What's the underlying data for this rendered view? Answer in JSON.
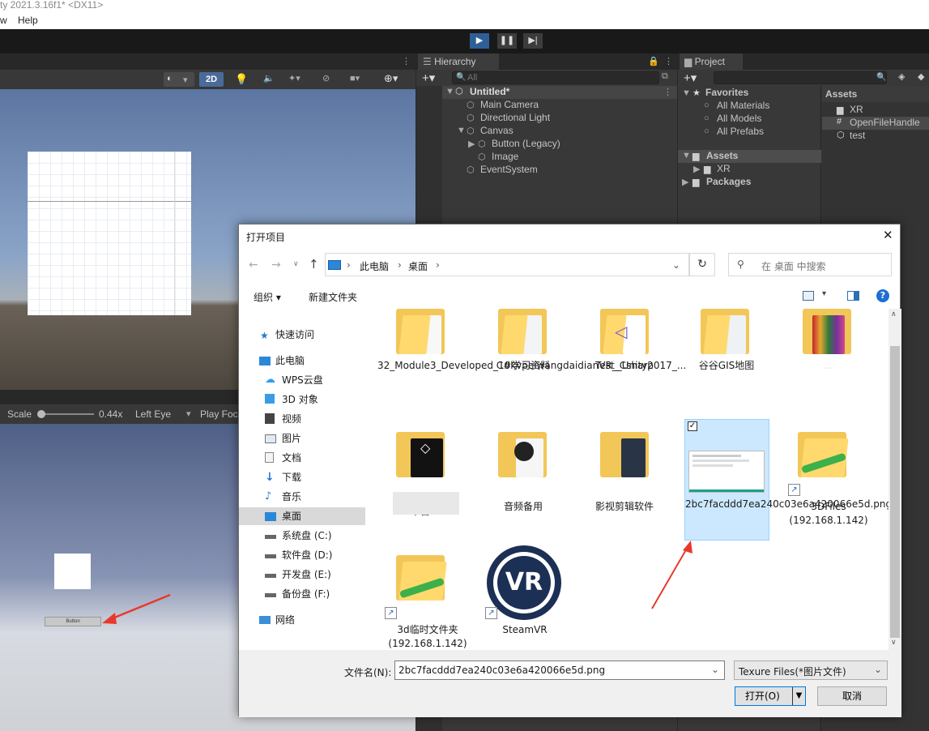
{
  "window": {
    "title": "ty 2021.3.16f1* <DX11>",
    "menu": [
      "w",
      "Help"
    ]
  },
  "scene_toolbar": {
    "mode_2d": "2D"
  },
  "game_toolbar": {
    "scale_label": "Scale",
    "scale_value": "0.44x",
    "eye": "Left Eye",
    "play_focus": "Play Foc"
  },
  "hierarchy": {
    "tab": "Hierarchy",
    "search_placeholder": "All",
    "items": [
      {
        "label": "Untitled*"
      },
      {
        "label": "Main Camera"
      },
      {
        "label": "Directional Light"
      },
      {
        "label": "Canvas"
      },
      {
        "label": "Button (Legacy)"
      },
      {
        "label": "Image"
      },
      {
        "label": "EventSystem"
      }
    ]
  },
  "project": {
    "tab": "Project",
    "favorites_header": "Favorites",
    "favorites": [
      "All Materials",
      "All Models",
      "All Prefabs"
    ],
    "assets_header": "Assets",
    "assets_tree": [
      "XR"
    ],
    "packages": "Packages",
    "assets_panel_title": "Assets",
    "assets_items": [
      "XR",
      "OpenFileHandle",
      "test"
    ]
  },
  "game_view": {
    "button_text": "Button"
  },
  "dialog": {
    "title": "打开项目",
    "close": "✕",
    "breadcrumb": [
      "此电脑",
      "桌面"
    ],
    "search_placeholder": "在 桌面 中搜索",
    "organize": "组织 ▾",
    "new_folder": "新建文件夹",
    "sidebar": [
      {
        "label": "快速访问",
        "icon": "star-icon"
      },
      {
        "label": "此电脑",
        "icon": "computer-icon"
      },
      {
        "label": "WPS云盘",
        "icon": "cloud-icon"
      },
      {
        "label": "3D 对象",
        "icon": "cube-icon"
      },
      {
        "label": "视频",
        "icon": "video-icon"
      },
      {
        "label": "图片",
        "icon": "picture-icon"
      },
      {
        "label": "文档",
        "icon": "document-icon"
      },
      {
        "label": "下载",
        "icon": "download-icon"
      },
      {
        "label": "音乐",
        "icon": "music-icon"
      },
      {
        "label": "桌面",
        "icon": "desktop-icon"
      },
      {
        "label": "系统盘 (C:)",
        "icon": "drive-icon"
      },
      {
        "label": "软件盘 (D:)",
        "icon": "drive-icon"
      },
      {
        "label": "开发盘 (E:)",
        "icon": "drive-icon"
      },
      {
        "label": "备份盘 (F:)",
        "icon": "drive-icon"
      },
      {
        "label": "网络",
        "icon": "network-icon"
      }
    ],
    "files": [
      {
        "name": "32_Module3_Developed_10kvpeiwangdaidianVR__Unity2017_..."
      },
      {
        "name": "C#学习资料"
      },
      {
        "name": "Test_Csharp"
      },
      {
        "name": "谷谷GIS地图"
      },
      {
        "name": "..."
      },
      {
        "name": "平台"
      },
      {
        "name": "音频备用"
      },
      {
        "name": "影视剪辑软件"
      },
      {
        "name": "2bc7facddd7ea240c03e6a420066e5d.png"
      },
      {
        "name": "3DFiles (192.168.1.142)"
      },
      {
        "name": "3d临时文件夹 (192.168.1.142)"
      },
      {
        "name": "SteamVR"
      }
    ],
    "filename_label": "文件名(N):",
    "filename_value": "2bc7facddd7ea240c03e6a420066e5d.png",
    "filetype": "Texure Files(*图片文件)",
    "open_button": "打开(O)",
    "cancel_button": "取消",
    "vr_logo_text": "VR"
  },
  "colors": {
    "unity_dark": "#383838",
    "dialog_select": "#cce8ff",
    "folder_yellow": "#f2c657",
    "annotation_red": "#e8392c"
  }
}
